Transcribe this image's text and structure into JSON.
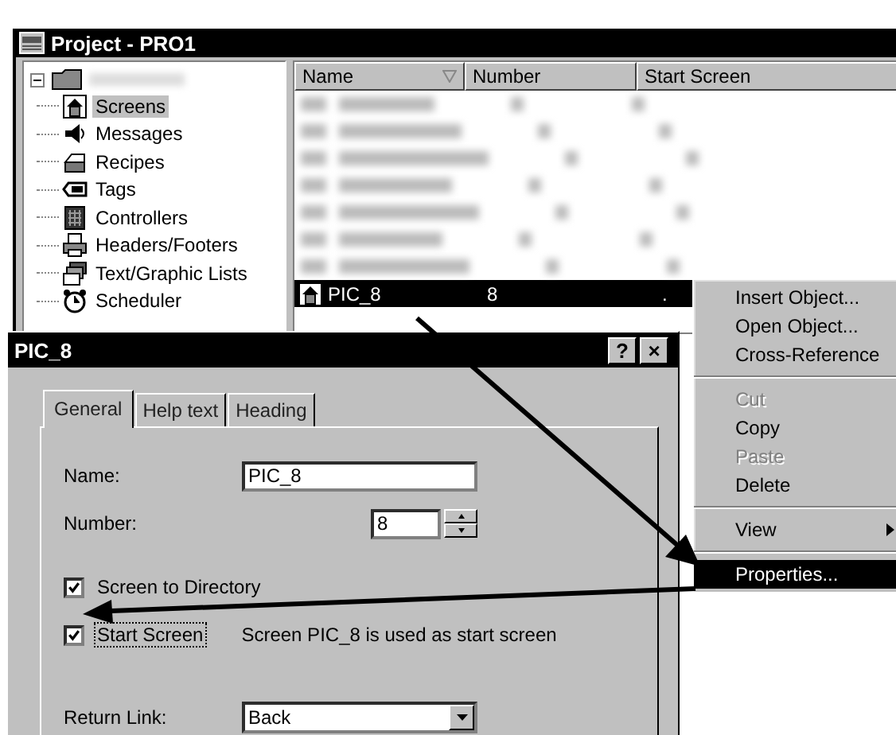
{
  "project_window": {
    "title": "Project - PRO1",
    "tree": {
      "expanded": true,
      "children": [
        {
          "label": "Screens",
          "selected": true
        },
        {
          "label": "Messages",
          "selected": false
        },
        {
          "label": "Recipes",
          "selected": false
        },
        {
          "label": "Tags",
          "selected": false
        },
        {
          "label": "Controllers",
          "selected": false
        },
        {
          "label": "Headers/Footers",
          "selected": false
        },
        {
          "label": "Text/Graphic Lists",
          "selected": false
        },
        {
          "label": "Scheduler",
          "selected": false
        }
      ]
    },
    "list": {
      "columns": [
        {
          "label": "Name",
          "sorted": true
        },
        {
          "label": "Number",
          "sorted": false
        },
        {
          "label": "Start Screen",
          "sorted": false
        }
      ],
      "rows": [
        {
          "name": "PIC_8",
          "number": "8",
          "start_screen": ".",
          "selected": true
        }
      ]
    }
  },
  "dialog": {
    "title": "PIC_8",
    "title_buttons": [
      "?",
      "×"
    ],
    "tabs": [
      {
        "label": "General",
        "selected": true
      },
      {
        "label": "Help text",
        "selected": false
      },
      {
        "label": "Heading",
        "selected": false
      }
    ],
    "name_field": {
      "label": "Name:",
      "value": "PIC_8"
    },
    "number_field": {
      "label": "Number:",
      "value": "8"
    },
    "checkboxes": [
      {
        "label": "Screen to Directory",
        "checked": true,
        "focused": false
      },
      {
        "label": "Start Screen",
        "checked": true,
        "focused": true,
        "note": "Screen PIC_8 is used as start screen"
      }
    ],
    "return_link": {
      "label": "Return Link:",
      "value": "Back"
    }
  },
  "context_menu": {
    "items": [
      {
        "kind": "item",
        "label": "Insert Object...",
        "disabled": false,
        "selected": false
      },
      {
        "kind": "item",
        "label": "Open Object...",
        "disabled": false,
        "selected": false
      },
      {
        "kind": "item",
        "label": "Cross-Reference",
        "disabled": false,
        "selected": false
      },
      {
        "kind": "separator"
      },
      {
        "kind": "item",
        "label": "Cut",
        "disabled": true,
        "selected": false
      },
      {
        "kind": "item",
        "label": "Copy",
        "disabled": false,
        "selected": false
      },
      {
        "kind": "item",
        "label": "Paste",
        "disabled": true,
        "selected": false
      },
      {
        "kind": "item",
        "label": "Delete",
        "disabled": false,
        "selected": false
      },
      {
        "kind": "separator"
      },
      {
        "kind": "submenu",
        "label": "View",
        "disabled": false,
        "selected": false
      },
      {
        "kind": "separator"
      },
      {
        "kind": "item",
        "label": "Properties...",
        "disabled": false,
        "selected": true
      }
    ]
  }
}
